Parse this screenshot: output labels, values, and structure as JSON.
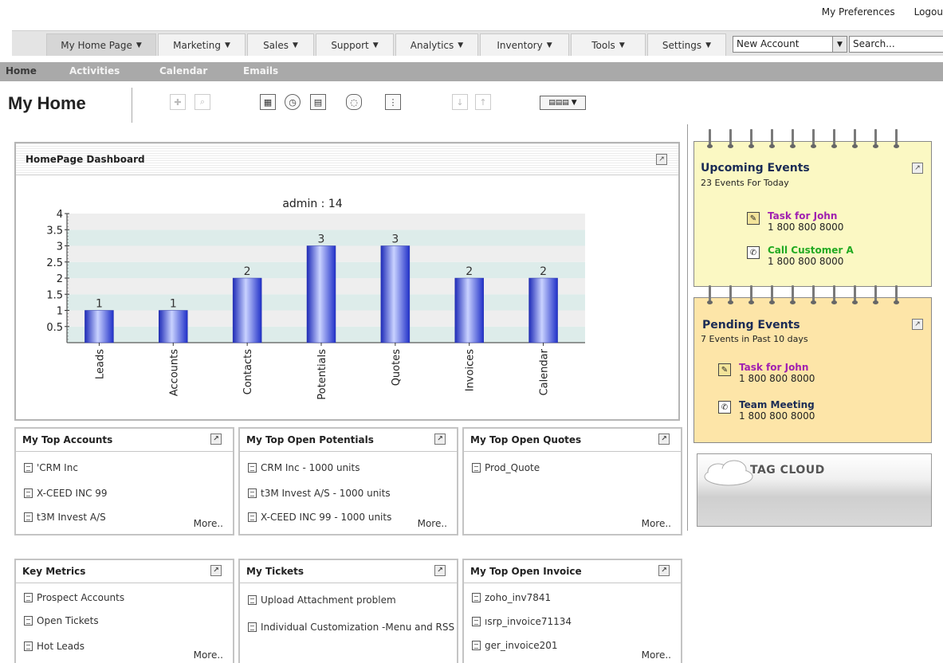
{
  "top_links": {
    "preferences": "My Preferences",
    "logout": "Logou"
  },
  "nav": {
    "tabs": [
      "My Home Page",
      "Marketing",
      "Sales",
      "Support",
      "Analytics",
      "Inventory",
      "Tools",
      "Settings"
    ],
    "active_tab": "My Home Page",
    "quick_create": "New Account",
    "search_placeholder": "Search..."
  },
  "subnav": {
    "items": [
      "Home",
      "Activities",
      "Calendar",
      "Emails"
    ],
    "active": "Home"
  },
  "page": {
    "title": "My Home"
  },
  "toolbar": {
    "icons": [
      "add-icon",
      "search-icon",
      "calendar-icon",
      "clock-icon",
      "calculator-icon",
      "chat-icon",
      "import-icon",
      "download-icon",
      "upload-icon",
      "layout-icon"
    ],
    "layout_label": "▤▤▤"
  },
  "dashboard": {
    "title": "HomePage Dashboard"
  },
  "chart_data": {
    "type": "bar",
    "title": "admin : 14",
    "categories": [
      "Leads",
      "Accounts",
      "Contacts",
      "Potentials",
      "Quotes",
      "Invoices",
      "Calendar"
    ],
    "values": [
      1,
      1,
      2,
      3,
      3,
      2,
      2
    ],
    "ylim": [
      0,
      4
    ],
    "yticks": [
      "0.5",
      "1",
      "1.5",
      "2",
      "2.5",
      "3",
      "3.5",
      "4"
    ],
    "grid": true,
    "colors": {
      "bar": "#3a48d8",
      "band_a": "#ddecea",
      "band_b": "#eeeeee"
    }
  },
  "widgets": {
    "top_accounts": {
      "title": "My Top Accounts",
      "items": [
        "'CRM Inc",
        "X-CEED INC 99",
        "t3M Invest A/S"
      ],
      "more": "More.."
    },
    "top_potentials": {
      "title": "My Top Open Potentials",
      "items": [
        "CRM Inc - 1000 units",
        "t3M Invest A/S - 1000 units",
        "X-CEED INC 99 - 1000 units"
      ],
      "more": "More.."
    },
    "top_quotes": {
      "title": "My Top Open Quotes",
      "items": [
        "Prod_Quote"
      ],
      "more": "More.."
    },
    "key_metrics": {
      "title": "Key Metrics",
      "items": [
        "Prospect Accounts",
        "Open Tickets",
        "Hot Leads"
      ],
      "more": "More.."
    },
    "tickets": {
      "title": "My Tickets",
      "items": [
        "Upload Attachment problem",
        "Individual Customization -Menu and RSS"
      ]
    },
    "top_invoice": {
      "title": "My Top Open Invoice",
      "items": [
        "zoho_inv7841",
        "ısrp_invoice71134",
        "ger_invoice201"
      ],
      "more": "More.."
    }
  },
  "upcoming": {
    "title": "Upcoming Events",
    "subtitle": "23 Events For Today",
    "bg": "#fbf8c3",
    "events": [
      {
        "name": "Task for John",
        "phone": "1 800 800 8000",
        "color": "#a020b0",
        "icon": "task-icon"
      },
      {
        "name": "Call Customer A",
        "phone": "1 800 800 8000",
        "color": "#22aa22",
        "icon": "phone-icon"
      }
    ]
  },
  "pending": {
    "title": "Pending Events",
    "subtitle": "7 Events in Past 10 days",
    "bg": "#fde5a8",
    "events": [
      {
        "name": "Task for John",
        "phone": "1 800 800 8000",
        "color": "#a020b0",
        "icon": "task-icon"
      },
      {
        "name": "Team Meeting",
        "phone": "1 800 800 8000",
        "color": "#1a2b55",
        "icon": "phone-icon"
      }
    ]
  },
  "tag_cloud": {
    "title": "TAG CLOUD"
  }
}
